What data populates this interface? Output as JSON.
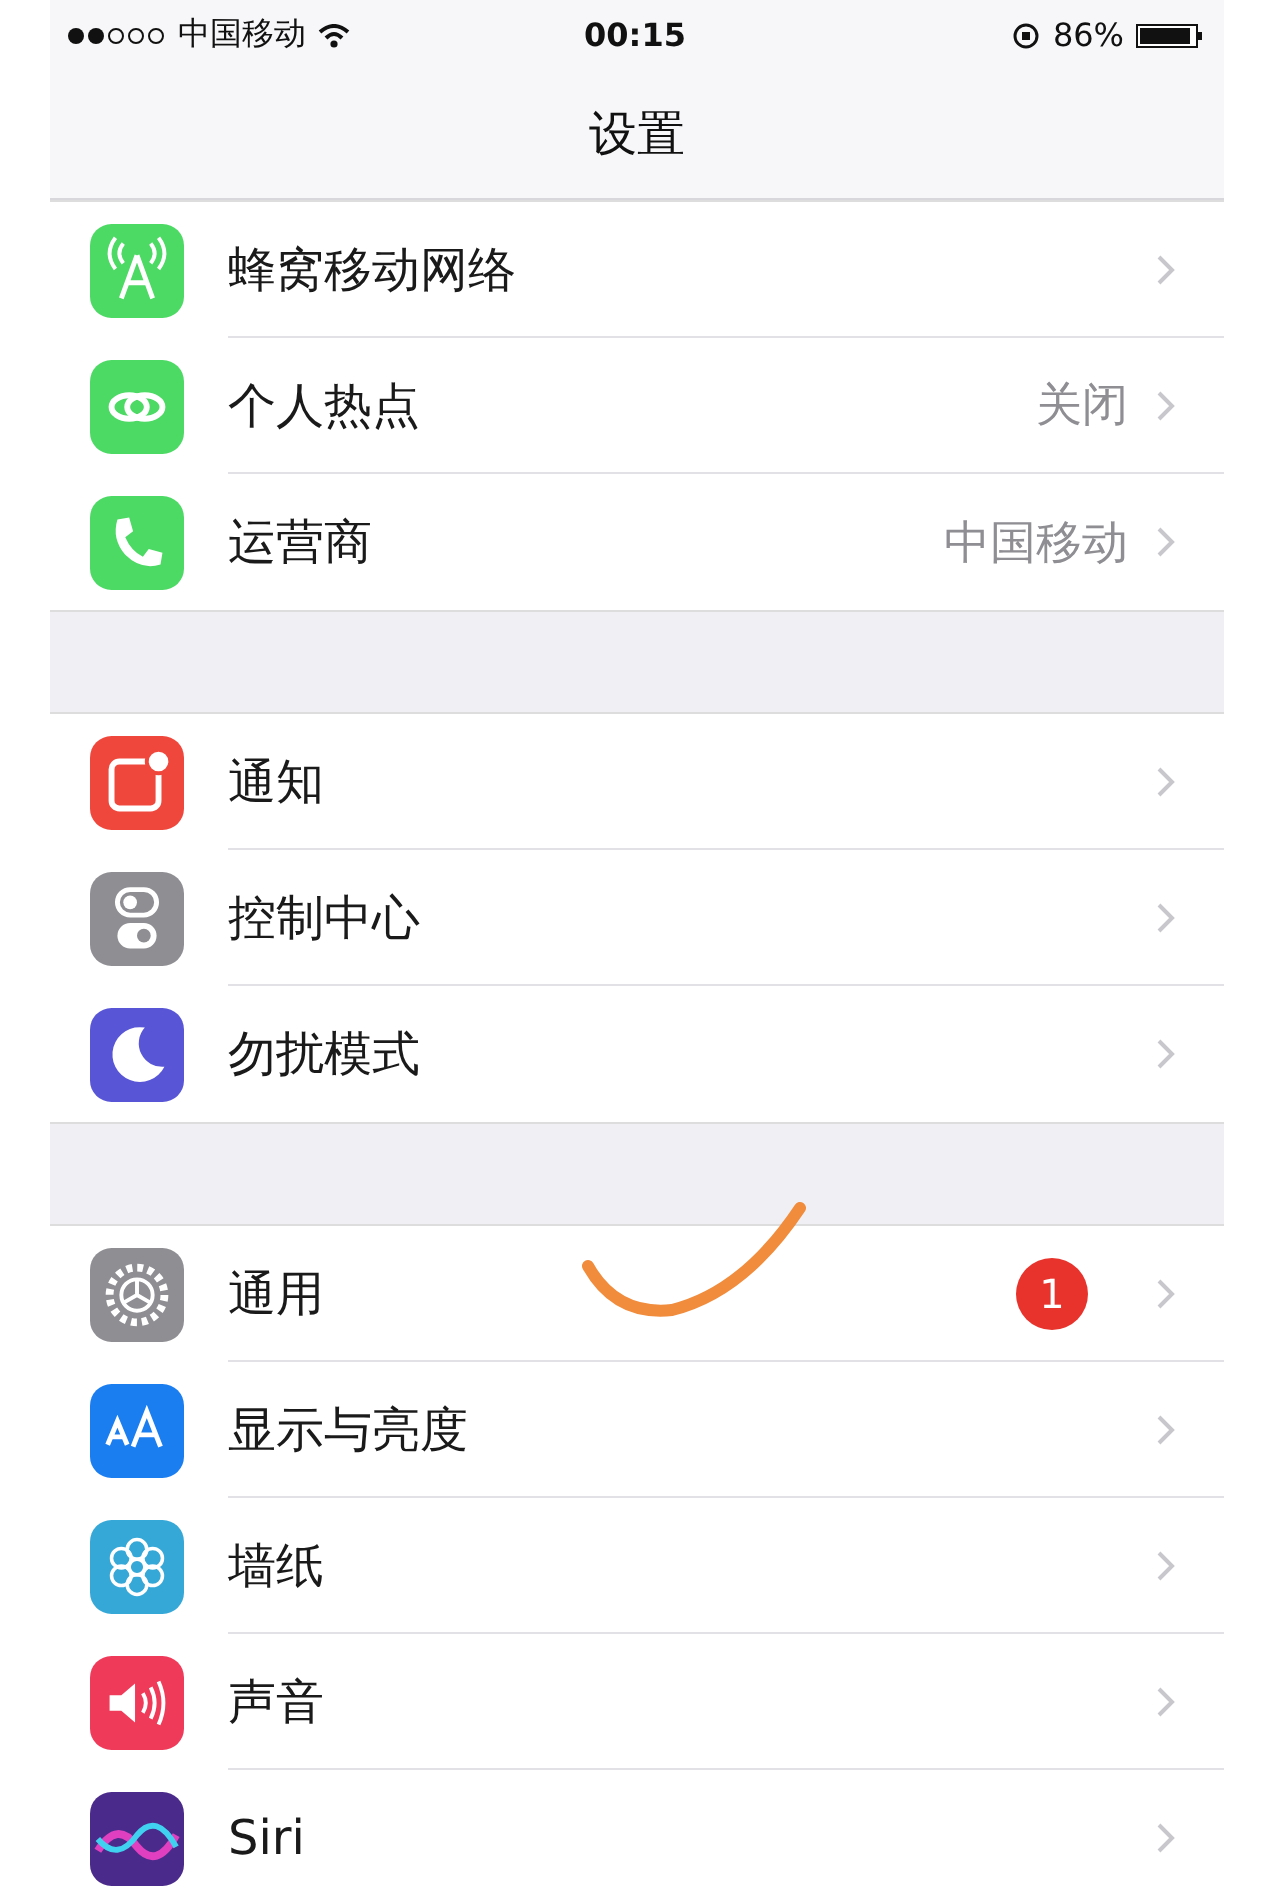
{
  "status_bar": {
    "carrier": "中国移动",
    "time": "00:15",
    "battery": "86%"
  },
  "nav_bar": {
    "title": "设置"
  },
  "groups": [
    {
      "rows": [
        {
          "color": "#4cd964",
          "label": "蜂窝移动网络"
        },
        {
          "color": "#4cd964",
          "label": "个人热点",
          "detail": "关闭"
        },
        {
          "color": "#4cd964",
          "label": "运营商",
          "detail": "中国移动"
        }
      ]
    },
    {
      "rows": [
        {
          "color": "#f0473c",
          "label": "通知"
        },
        {
          "color": "#8e8e93",
          "label": "控制中心"
        },
        {
          "color": "#5856d6",
          "label": "勿扰模式"
        }
      ]
    },
    {
      "rows": [
        {
          "color": "#8e8e93",
          "label": "通用",
          "badge": "1"
        },
        {
          "color": "#1a7ef0",
          "label": "显示与亮度"
        },
        {
          "color": "#35a8d8",
          "label": "墙纸"
        },
        {
          "color": "#f03a5a",
          "label": "声音"
        },
        {
          "color": "#4a2a8a",
          "label": "Siri"
        }
      ]
    }
  ]
}
